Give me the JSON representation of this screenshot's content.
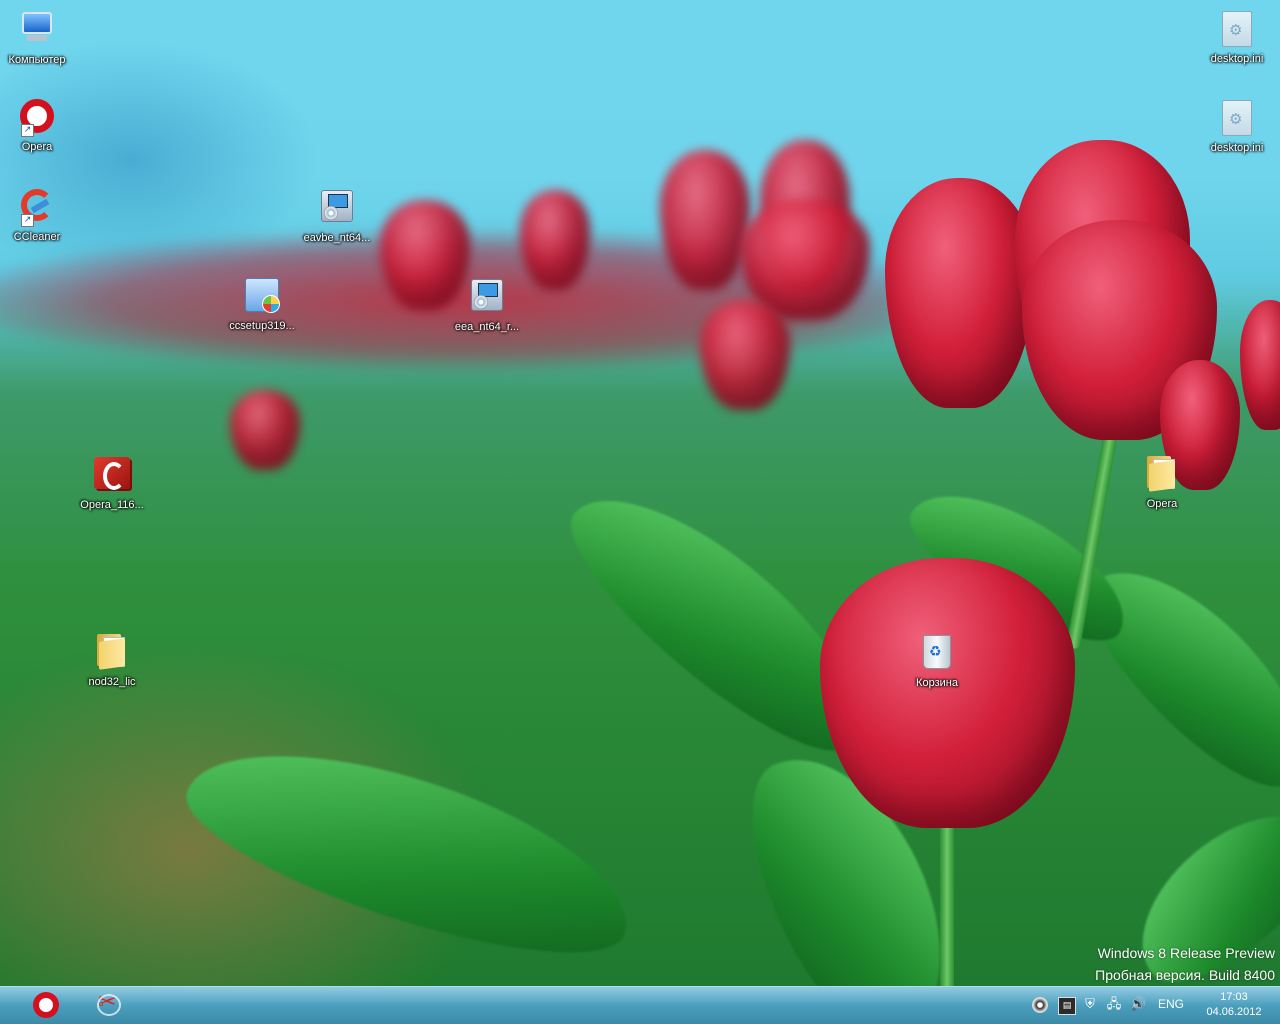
{
  "desktop": {
    "icons": [
      {
        "id": "computer",
        "label": "Компьютер",
        "icon": "computer-icon"
      },
      {
        "id": "opera",
        "label": "Opera",
        "icon": "opera-icon"
      },
      {
        "id": "ccleaner",
        "label": "CCleaner",
        "icon": "ccleaner-icon"
      },
      {
        "id": "eavbe",
        "label": "eavbe_nt64...",
        "icon": "installer-icon"
      },
      {
        "id": "ccsetup",
        "label": "ccsetup319...",
        "icon": "setup-icon"
      },
      {
        "id": "eea",
        "label": "eea_nt64_r...",
        "icon": "installer-icon"
      },
      {
        "id": "opera116",
        "label": "Opera_116...",
        "icon": "opera-package-icon"
      },
      {
        "id": "nod32",
        "label": "nod32_lic",
        "icon": "folder-icon"
      },
      {
        "id": "recycle",
        "label": "Корзина",
        "icon": "recycle-bin-icon"
      },
      {
        "id": "opera_folder",
        "label": "Opera",
        "icon": "folder-icon"
      },
      {
        "id": "desktop_ini_1",
        "label": "desktop.ini",
        "icon": "settings-file-icon"
      },
      {
        "id": "desktop_ini_2",
        "label": "desktop.ini",
        "icon": "settings-file-icon"
      }
    ]
  },
  "watermark": {
    "line1": "Windows 8 Release Preview",
    "line2": "Пробная версия. Build 8400"
  },
  "taskbar": {
    "pinned": [
      {
        "name": "Opera",
        "icon": "opera-icon"
      },
      {
        "name": "Snipping Tool",
        "icon": "scissors-icon"
      }
    ],
    "tray": {
      "icons": [
        "media-icon",
        "monitor-icon",
        "security-shield-icon",
        "network-icon",
        "volume-icon"
      ],
      "language": "ENG",
      "time": "17:03",
      "date": "04.06.2012"
    }
  },
  "colors": {
    "sky": "#6fd6ee",
    "taskbar": "#4b9fbd",
    "tulip_red": "#d21f3a",
    "leaf_green": "#1d8a2b"
  }
}
